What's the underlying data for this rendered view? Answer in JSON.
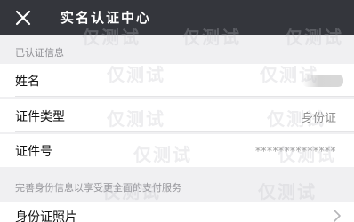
{
  "titlebar": {
    "title": "实名认证中心",
    "close_icon": "close-icon"
  },
  "section_header": "已认证信息",
  "rows": {
    "name": {
      "label": "姓名",
      "value": ""
    },
    "id_type": {
      "label": "证件类型",
      "value": "身份证"
    },
    "id_number": {
      "label": "证件号",
      "value": "**************"
    }
  },
  "hint": "完善身份信息以享受更全面的支付服务",
  "photo_row": {
    "label": "身份证照片",
    "chevron_icon": "chevron-right-icon"
  },
  "watermark": "仅测试",
  "colors": {
    "titlebar_bg": "#34363c",
    "page_bg": "#f0f0f2",
    "row_bg": "#ffffff"
  }
}
